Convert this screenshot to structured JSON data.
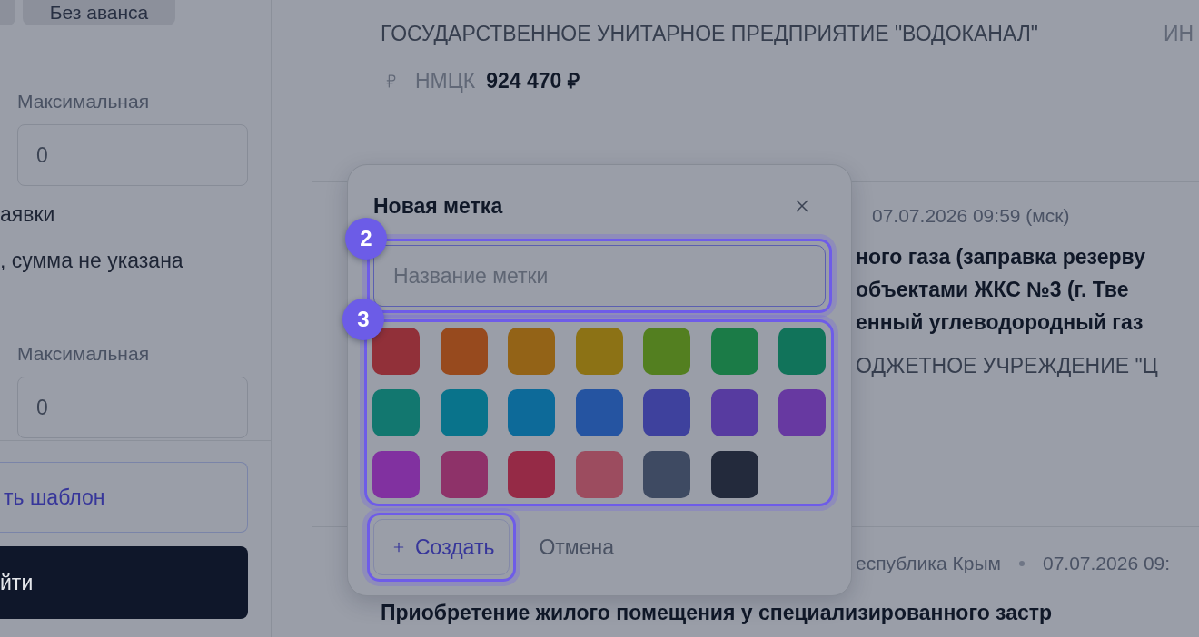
{
  "sidebar": {
    "chips": [
      {
        "label": "Без аванса"
      }
    ],
    "sections": [
      {
        "kind": "range",
        "label": "Максимальная",
        "value": "0"
      },
      {
        "kind": "option",
        "label": "аявки"
      },
      {
        "kind": "option",
        "label": ", сумма не указана"
      },
      {
        "kind": "range",
        "label": "Максимальная",
        "value": "0"
      }
    ],
    "buttons": [
      {
        "kind": "outline",
        "label": "ть шаблон"
      },
      {
        "kind": "primary",
        "label": "йти"
      }
    ]
  },
  "results": [
    {
      "customer": "ГОСУДАРСТВЕННОЕ УНИТАРНОЕ ПРЕДПРИЯТИЕ \"ВОДОКАНАЛ\"",
      "inn": "ИН",
      "price_label": "НМЦК",
      "price": "924 470 ₽"
    },
    {
      "date": "07.07.2026 09:59 (мск)",
      "title_lines": [
        "ного газа (заправка резерву",
        "объектами ЖКС №3 (г. Тве",
        "енный углеводородный газ"
      ],
      "customer": "ОДЖЕТНОЕ УЧРЕЖДЕНИЕ \"Ц"
    },
    {
      "region": "еспублика Крым",
      "date": "07.07.2026 09:",
      "title_lines": [
        "Приобретение жилого помещения у специализированного застр"
      ]
    }
  ],
  "popover": {
    "title": "Новая метка",
    "name_field": {
      "placeholder": "Название метки",
      "highlighted": true,
      "step": "2"
    },
    "palette": {
      "highlighted": true,
      "step": "3",
      "colors": [
        {
          "color": "#913039"
        },
        {
          "color": "#974a1e"
        },
        {
          "color": "#936317"
        },
        {
          "color": "#8c7215"
        },
        {
          "color": "#537f20"
        },
        {
          "color": "#1b7b47"
        },
        {
          "color": "#11735a"
        },
        {
          "color": "#12776f"
        },
        {
          "color": "#09738b"
        },
        {
          "color": "#0d6a99"
        },
        {
          "color": "#2554a1"
        },
        {
          "color": "#3e419d"
        },
        {
          "color": "#573ba0"
        },
        {
          "color": "#6739a1"
        },
        {
          "color": "#8131a0"
        },
        {
          "color": "#8e3269"
        },
        {
          "color": "#952a46"
        },
        {
          "color": "#9c4c5f"
        },
        {
          "color": "#3e4a62"
        },
        {
          "color": "#232a3c"
        }
      ]
    },
    "buttons": [
      {
        "kind": "create",
        "label": "Создать",
        "highlighted": true
      },
      {
        "kind": "cancel",
        "label": "Отмена",
        "highlighted": false
      }
    ]
  }
}
